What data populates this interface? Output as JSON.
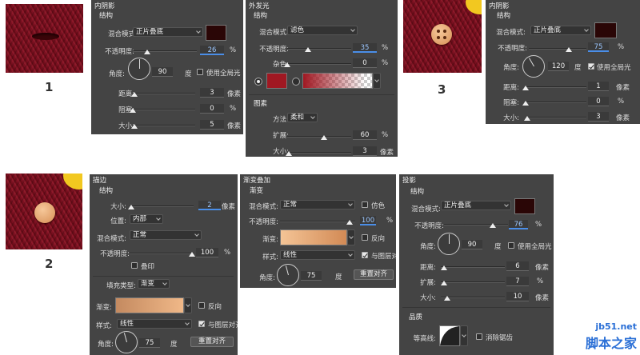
{
  "steps": {
    "one": "1",
    "two": "2",
    "three": "3"
  },
  "common": {
    "pct": "%",
    "px": "像素",
    "deg": "度",
    "blend_label": "混合模式:",
    "opacity_label": "不透明度:",
    "angle_label": "角度:",
    "distance_label": "距离:",
    "choke_label": "阻塞:",
    "spread_label": "扩展:",
    "size_label": "大小:",
    "structure": "结构",
    "global_light": "使用全局光",
    "reset_align": "重置对齐",
    "align_layer": "与图层对齐",
    "reverse": "反向",
    "style_label": "样式:",
    "gradient_label": "渐变:",
    "linear": "线性"
  },
  "inner_shadow_1": {
    "title": "内阴影",
    "blend": "正片叠底",
    "color": "#2a0606",
    "opacity": "26",
    "angle": "90",
    "distance": "3",
    "choke": "0",
    "size": "5"
  },
  "outer_glow": {
    "title": "外发光",
    "blend": "滤色",
    "opacity": "35",
    "noise_label": "杂色:",
    "noise": "0",
    "color": "#a01822",
    "section": "图素",
    "method_label": "方法:",
    "method": "柔和",
    "spread": "60",
    "size": "3"
  },
  "inner_shadow_3": {
    "title": "内阴影",
    "blend": "正片叠底",
    "color": "#2a0606",
    "opacity": "75",
    "angle": "120",
    "distance": "1",
    "choke": "0",
    "size": "3"
  },
  "stroke": {
    "title": "描边",
    "size": "2",
    "position_label": "位置:",
    "position": "内部",
    "blend": "正常",
    "opacity": "100",
    "overprint": "叠印",
    "fill_type_label": "填充类型:",
    "fill_type": "渐变",
    "angle": "75"
  },
  "gradient_overlay": {
    "title": "渐变叠加",
    "section": "渐变",
    "blend": "正常",
    "dither": "仿色",
    "opacity": "100",
    "angle": "75"
  },
  "drop_shadow": {
    "title": "投影",
    "blend": "正片叠底",
    "color": "#2a0606",
    "opacity": "76",
    "distance": "6",
    "spread": "7",
    "size": "10",
    "quality": "品质",
    "contour_label": "等高线:",
    "anti_alias": "消除锯齿"
  },
  "watermark": {
    "site": "jb51.net",
    "name": "脚本之家"
  },
  "colors": {
    "panel": "#444444",
    "accent": "#4a8ee8",
    "knit": "#7a1020"
  }
}
